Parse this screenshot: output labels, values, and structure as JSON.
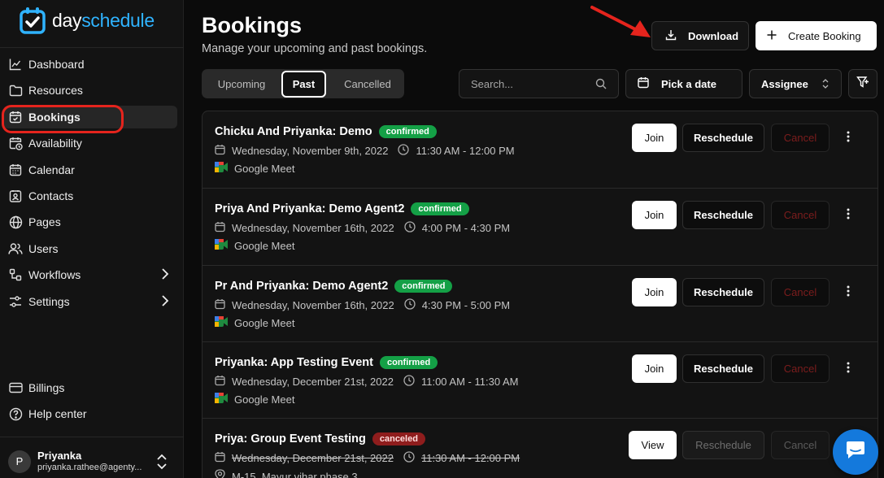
{
  "brand": {
    "logo_part1": "day",
    "logo_part2": "schedule",
    "accent": "#2fb3ff"
  },
  "sidebar": {
    "items": [
      {
        "label": "Dashboard",
        "icon": "chart-line-icon"
      },
      {
        "label": "Resources",
        "icon": "folder-icon"
      },
      {
        "label": "Bookings",
        "icon": "calendar-check-icon",
        "active": true
      },
      {
        "label": "Availability",
        "icon": "calendar-clock-icon"
      },
      {
        "label": "Calendar",
        "icon": "calendar-icon"
      },
      {
        "label": "Contacts",
        "icon": "contact-card-icon"
      },
      {
        "label": "Pages",
        "icon": "globe-icon"
      },
      {
        "label": "Users",
        "icon": "users-icon"
      },
      {
        "label": "Workflows",
        "icon": "workflow-icon",
        "expandable": true
      },
      {
        "label": "Settings",
        "icon": "sliders-icon",
        "expandable": true
      }
    ],
    "bottom_items": [
      {
        "label": "Billings",
        "icon": "credit-card-icon"
      },
      {
        "label": "Help center",
        "icon": "help-circle-icon"
      }
    ],
    "user": {
      "initial": "P",
      "name": "Priyanka",
      "email": "priyanka.rathee@agenty..."
    }
  },
  "header": {
    "title": "Bookings",
    "subtitle": "Manage your upcoming and past bookings.",
    "download_label": "Download",
    "create_label": "Create Booking"
  },
  "filters": {
    "tabs": [
      "Upcoming",
      "Past",
      "Cancelled"
    ],
    "active_tab": "Past",
    "search_placeholder": "Search...",
    "date_label": "Pick a date",
    "assignee_label": "Assignee"
  },
  "bookings": [
    {
      "title": "Chicku And Priyanka: Demo",
      "status": "confirmed",
      "date": "Wednesday, November 9th, 2022",
      "time": "11:30 AM - 12:00 PM",
      "location": "Google Meet",
      "primary": "Join",
      "reschedule": "Reschedule",
      "cancel": "Cancel"
    },
    {
      "title": "Priya And Priyanka: Demo Agent2",
      "status": "confirmed",
      "date": "Wednesday, November 16th, 2022",
      "time": "4:00 PM - 4:30 PM",
      "location": "Google Meet",
      "primary": "Join",
      "reschedule": "Reschedule",
      "cancel": "Cancel"
    },
    {
      "title": "Pr And Priyanka: Demo Agent2",
      "status": "confirmed",
      "date": "Wednesday, November 16th, 2022",
      "time": "4:30 PM - 5:00 PM",
      "location": "Google Meet",
      "primary": "Join",
      "reschedule": "Reschedule",
      "cancel": "Cancel"
    },
    {
      "title": "Priyanka: App Testing Event",
      "status": "confirmed",
      "date": "Wednesday, December 21st, 2022",
      "time": "11:00 AM - 11:30 AM",
      "location": "Google Meet",
      "primary": "Join",
      "reschedule": "Reschedule",
      "cancel": "Cancel"
    },
    {
      "title": "Priya: Group Event Testing",
      "status": "canceled",
      "date": "Wednesday, December 21st, 2022",
      "time": "11:30 AM - 12:00 PM",
      "location": "M-15, Mayur vihar phase 3",
      "primary": "View",
      "reschedule": "Reschedule",
      "cancel": "Cancel"
    }
  ],
  "colors": {
    "confirmed": "#14a046",
    "canceled": "#8f1d1d",
    "highlight": "#e5241d",
    "chat": "#1479dc"
  }
}
